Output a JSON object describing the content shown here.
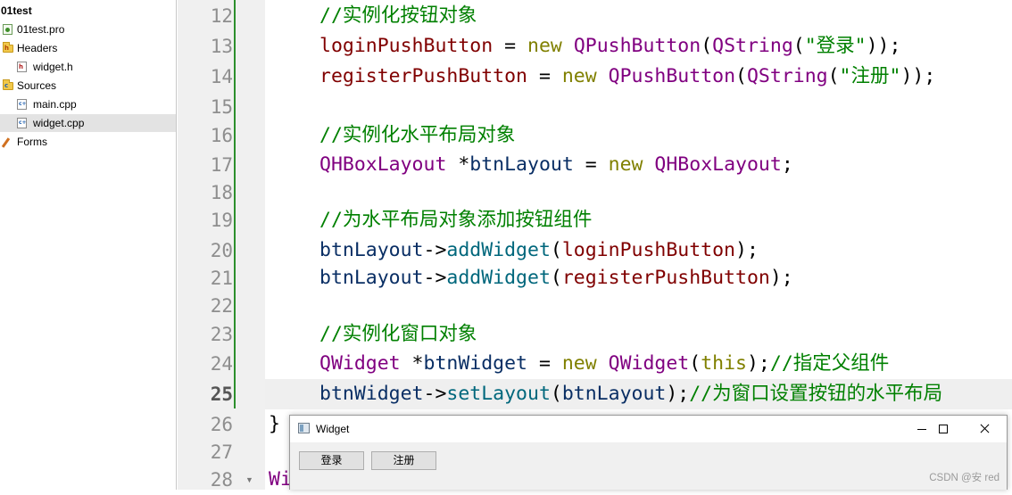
{
  "project_tree": {
    "root": "01test",
    "items": [
      {
        "label": "01test.pro",
        "icon": "pro-file-icon"
      },
      {
        "label": "Headers",
        "icon": "headers-folder-icon"
      },
      {
        "label": "widget.h",
        "icon": "header-file-icon"
      },
      {
        "label": "Sources",
        "icon": "sources-folder-icon"
      },
      {
        "label": "main.cpp",
        "icon": "cpp-file-icon"
      },
      {
        "label": "widget.cpp",
        "icon": "cpp-file-icon"
      },
      {
        "label": "Forms",
        "icon": "forms-folder-icon"
      }
    ],
    "selected_item": "widget.cpp"
  },
  "editor": {
    "current_line": "25",
    "line_numbers": [
      "12",
      "13",
      "14",
      "15",
      "16",
      "17",
      "18",
      "19",
      "20",
      "21",
      "22",
      "23",
      "24",
      "25",
      "26",
      "27",
      "28"
    ],
    "code": {
      "l12_comment": "//实例化按钮对象",
      "l13_var": "loginPushButton",
      "l13_eq": " = ",
      "l13_new": "new",
      "l13_sp": " ",
      "l13_class": "QPushButton",
      "l13_p1": "(",
      "l13_qstring": "QString",
      "l13_p2": "(",
      "l13_str": "\"登录\"",
      "l13_end": "));",
      "l14_var": "registerPushButton",
      "l14_eq": " = ",
      "l14_new": "new",
      "l14_sp": " ",
      "l14_class": "QPushButton",
      "l14_p1": "(",
      "l14_qstring": "QString",
      "l14_p2": "(",
      "l14_str": "\"注册\"",
      "l14_end": "));",
      "l16_comment": "//实例化水平布局对象",
      "l17_type": "QHBoxLayout",
      "l17_ptr": " *",
      "l17_var": "btnLayout",
      "l17_eq": " = ",
      "l17_new": "new",
      "l17_sp": " ",
      "l17_class": "QHBoxLayout",
      "l17_end": ";",
      "l19_comment": "//为水平布局对象添加按钮组件",
      "l20_obj": "btnLayout",
      "l20_arrow": "->",
      "l20_fn": "addWidget",
      "l20_p": "(",
      "l20_arg": "loginPushButton",
      "l20_end": ");",
      "l21_obj": "btnLayout",
      "l21_arrow": "->",
      "l21_fn": "addWidget",
      "l21_p": "(",
      "l21_arg": "registerPushButton",
      "l21_end": ");",
      "l23_comment": "//实例化窗口对象",
      "l24_type": "QWidget",
      "l24_ptr": " *",
      "l24_var": "btnWidget",
      "l24_eq": " = ",
      "l24_new": "new",
      "l24_sp": " ",
      "l24_class": "QWidget",
      "l24_p": "(",
      "l24_this": "this",
      "l24_end": ");",
      "l24_comment": "//指定父组件",
      "l25_obj": "btnWidget",
      "l25_arrow": "->",
      "l25_fn": "setLayout",
      "l25_p": "(",
      "l25_arg": "btnLayout",
      "l25_end": ");",
      "l25_comment": "//为窗口设置按钮的水平布局",
      "l26_brace": "}",
      "l28_partial": "Wi"
    }
  },
  "popup_window": {
    "title": "Widget",
    "buttons": [
      "登录",
      "注册"
    ]
  },
  "watermark": "CSDN @安 red"
}
